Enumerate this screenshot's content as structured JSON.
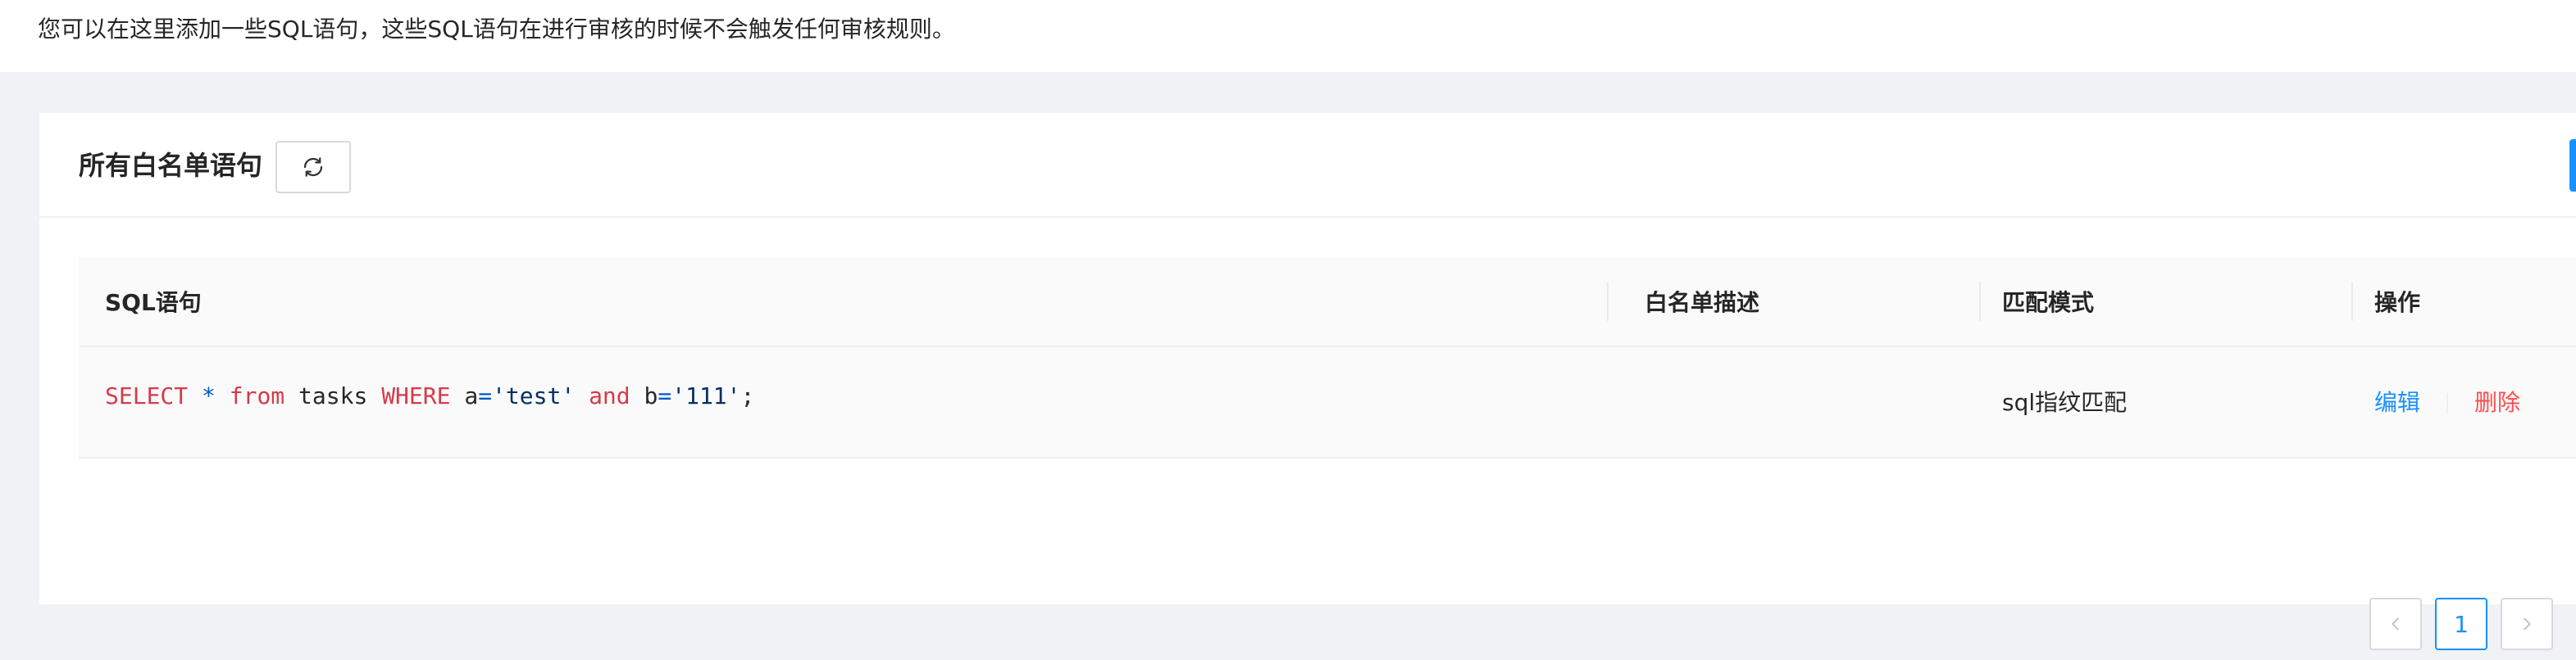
{
  "page": {
    "description": "您可以在这里添加一些SQL语句，这些SQL语句在进行审核的时候不会触发任何审核规则。"
  },
  "card": {
    "title": "所有白名单语句",
    "refresh_icon": "reload-icon"
  },
  "table": {
    "columns": [
      "SQL语句",
      "白名单描述",
      "匹配模式",
      "操作"
    ],
    "rows": [
      {
        "sql_tokens": [
          {
            "t": "SELECT",
            "c": "kw"
          },
          {
            "t": " ",
            "c": "plain"
          },
          {
            "t": "*",
            "c": "op"
          },
          {
            "t": " ",
            "c": "plain"
          },
          {
            "t": "from",
            "c": "kw"
          },
          {
            "t": " tasks ",
            "c": "plain"
          },
          {
            "t": "WHERE",
            "c": "kw"
          },
          {
            "t": " a",
            "c": "plain"
          },
          {
            "t": "=",
            "c": "op"
          },
          {
            "t": "'test'",
            "c": "str"
          },
          {
            "t": " ",
            "c": "plain"
          },
          {
            "t": "and",
            "c": "kw"
          },
          {
            "t": " b",
            "c": "plain"
          },
          {
            "t": "=",
            "c": "op"
          },
          {
            "t": "'111'",
            "c": "str"
          },
          {
            "t": ";",
            "c": "plain"
          }
        ],
        "description": "",
        "match_mode": "sql指纹匹配",
        "actions": {
          "edit": "编辑",
          "delete": "删除"
        }
      }
    ]
  },
  "pagination": {
    "prev_icon": "chevron-left-icon",
    "current_page": "1",
    "next_icon": "chevron-right-icon"
  },
  "colors": {
    "accent": "#1890ff",
    "danger": "#ff4d4f",
    "sql_keyword": "#d73a49",
    "sql_string": "#032f62"
  }
}
